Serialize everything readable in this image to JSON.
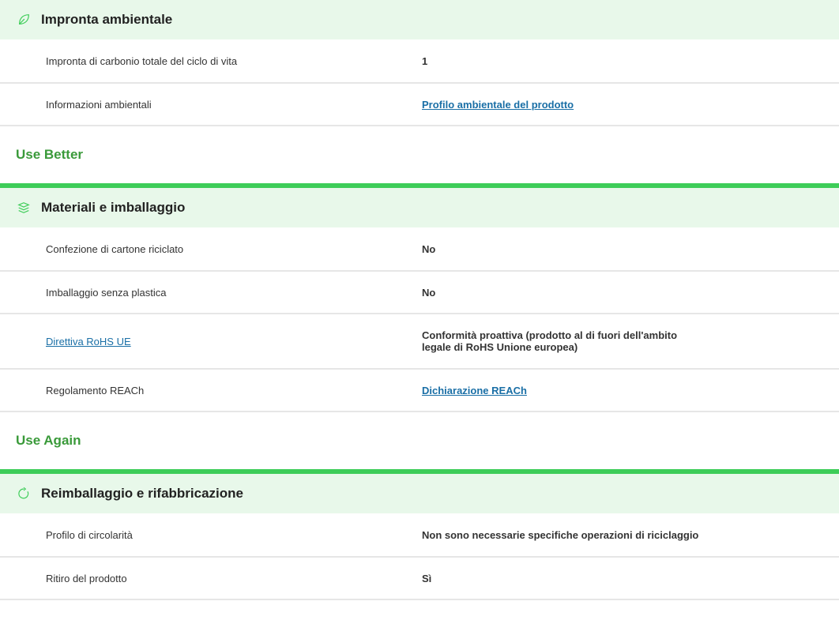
{
  "sections": {
    "footprint": {
      "title": "Impronta ambientale",
      "icon": "leaf-icon",
      "rows": [
        {
          "label": "Impronta di carbonio totale del ciclo di vita",
          "value": "1"
        },
        {
          "label": "Informazioni ambientali",
          "value": "Profilo ambientale del prodotto"
        }
      ]
    },
    "materials": {
      "group_title": "Use Better",
      "title": "Materiali e imballaggio",
      "icon": "layers-icon",
      "rows": [
        {
          "label": "Confezione di cartone riciclato",
          "value": "No"
        },
        {
          "label": "Imballaggio senza plastica",
          "value": "No"
        },
        {
          "label": "Direttiva RoHS UE",
          "value": "Conformità proattiva (prodotto al di fuori dell'ambito legale di RoHS Unione europea)"
        },
        {
          "label": "Regolamento REACh",
          "value": "Dichiarazione REACh"
        }
      ]
    },
    "reuse": {
      "group_title": "Use Again",
      "title": "Reimballaggio e rifabbricazione",
      "icon": "refresh-icon",
      "rows": [
        {
          "label": "Profilo di circolarità",
          "value": "Non sono necessarie specifiche operazioni di riciclaggio"
        },
        {
          "label": "Ritiro del prodotto",
          "value": "Sì"
        }
      ]
    }
  },
  "colors": {
    "accent_green": "#3dcd58",
    "header_bg": "#e8f8ea",
    "group_title": "#3a9a3a",
    "link": "#1a6fa6"
  }
}
